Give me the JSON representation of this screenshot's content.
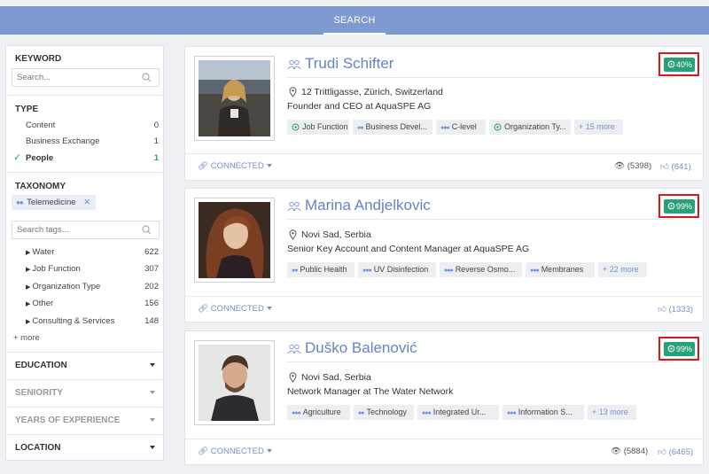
{
  "topbar": {
    "tab_label": "SEARCH"
  },
  "sidebar": {
    "keyword": {
      "title": "KEYWORD",
      "placeholder": "Search..."
    },
    "type": {
      "title": "TYPE",
      "items": [
        {
          "label": "Content",
          "count": "0"
        },
        {
          "label": "Business Exchange",
          "count": "1"
        },
        {
          "label": "People",
          "count": "1",
          "selected": true
        }
      ]
    },
    "taxonomy": {
      "title": "TAXONOMY",
      "chip": "Telemedicine",
      "tag_placeholder": "Search tags...",
      "items": [
        {
          "label": "Water",
          "count": "622"
        },
        {
          "label": "Job Function",
          "count": "307"
        },
        {
          "label": "Organization Type",
          "count": "202"
        },
        {
          "label": "Other",
          "count": "156"
        },
        {
          "label": "Consulting & Services",
          "count": "148"
        }
      ],
      "more_label": "+ more"
    },
    "sections": [
      "EDUCATION",
      "SENIORITY",
      "YEARS OF EXPERIENCE",
      "LOCATION"
    ]
  },
  "results": [
    {
      "name": "Trudi Schifter",
      "score": "40%",
      "location": "12 Trittligasse, Zürich, Switzerland",
      "role": "Founder and CEO at AquaSPE AG",
      "tags": [
        "Job Function",
        "Business Devel...",
        "C-level",
        "Organization Ty..."
      ],
      "more_tags": "+ 15 more",
      "connection": "CONNECTED",
      "views": "(5398)",
      "likes": "(841)"
    },
    {
      "name": "Marina Andjelkovic",
      "score": "99%",
      "location": "Novi Sad, Serbia",
      "role": "Senior Key Account and Content Manager at AquaSPE AG",
      "tags": [
        "Public Health",
        "UV Disinfection",
        "Reverse Osmo...",
        "Membranes"
      ],
      "more_tags": "+ 22 more",
      "connection": "CONNECTED",
      "likes": "(1333)"
    },
    {
      "name": "Duško Balenović",
      "score": "99%",
      "location": "Novi Sad, Serbia",
      "role": "Network Manager at The Water Network",
      "tags": [
        "Agriculture",
        "Technology",
        "Integrated Ur...",
        "Information S..."
      ],
      "more_tags": "+ 13 more",
      "connection": "CONNECTED",
      "views": "(5884)",
      "likes": "(6465)"
    }
  ],
  "colors": {
    "accent": "#7f9ad0",
    "link": "#6783c4",
    "score": "#26a17a",
    "highlight": "#e0141f"
  }
}
